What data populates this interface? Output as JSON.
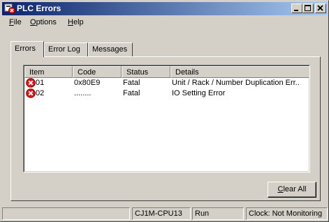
{
  "window": {
    "title": "PLC Errors"
  },
  "menu": [
    {
      "label": "File",
      "accel": "F",
      "rest": "ile"
    },
    {
      "label": "Options",
      "accel": "O",
      "rest": "ptions"
    },
    {
      "label": "Help",
      "accel": "H",
      "rest": "elp"
    }
  ],
  "tabs": [
    {
      "label": "Errors",
      "active": true
    },
    {
      "label": "Error Log",
      "active": false
    },
    {
      "label": "Messages",
      "active": false
    }
  ],
  "table": {
    "columns": [
      "Item",
      "Code",
      "Status",
      "Details"
    ],
    "rows": [
      {
        "icon": "error-icon",
        "item": "01",
        "code": "0x80E9",
        "status": "Fatal",
        "details": "Unit / Rack / Number Duplication Err.."
      },
      {
        "icon": "error-icon",
        "item": "02",
        "code": "........",
        "status": "Fatal",
        "details": "IO Setting Error"
      }
    ]
  },
  "buttons": {
    "clear_all_accel": "C",
    "clear_all_rest": "lear All"
  },
  "status_bar": {
    "blank": "",
    "cpu": "CJ1M-CPU13",
    "mode": "Run",
    "clock": "Clock: Not Monitoring"
  },
  "colors": {
    "title_start": "#0a246a",
    "title_end": "#a6caf0",
    "error_red": "#d81818",
    "face": "#d4d0c8"
  }
}
